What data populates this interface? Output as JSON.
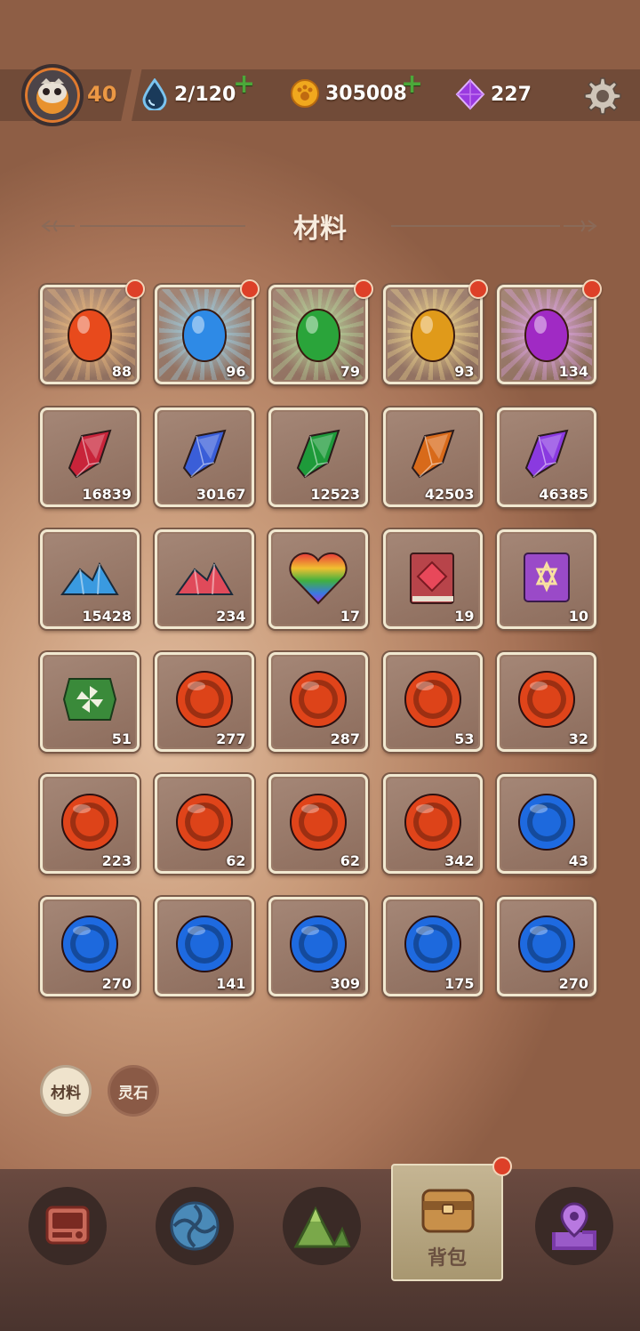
{
  "player": {
    "level": "40"
  },
  "resources": {
    "energy": "2/120",
    "coins": "305008",
    "gems": "227"
  },
  "section_title": "材料",
  "items": [
    {
      "icon": "red-egg-icon",
      "qty": "88",
      "badge": true,
      "kind": "egg",
      "color": "#e84a1c",
      "glow": "#f4c080"
    },
    {
      "icon": "blue-egg-icon",
      "qty": "96",
      "badge": true,
      "kind": "egg",
      "color": "#2e8ae6",
      "glow": "#9ed8f0"
    },
    {
      "icon": "green-egg-icon",
      "qty": "79",
      "badge": true,
      "kind": "egg",
      "color": "#2aa43a",
      "glow": "#b8e0a0"
    },
    {
      "icon": "yellow-egg-icon",
      "qty": "93",
      "badge": true,
      "kind": "egg",
      "color": "#e09a1a",
      "glow": "#f4dc90"
    },
    {
      "icon": "purple-egg-icon",
      "qty": "134",
      "badge": true,
      "kind": "egg",
      "color": "#a02ac4",
      "glow": "#e4a8f0"
    },
    {
      "icon": "red-crystal-icon",
      "qty": "16839",
      "kind": "crystal",
      "color": "#c8243a"
    },
    {
      "icon": "blue-crystal-icon",
      "qty": "30167",
      "kind": "crystal",
      "color": "#3a5ed8"
    },
    {
      "icon": "green-crystal-icon",
      "qty": "12523",
      "kind": "crystal",
      "color": "#1e9a3a"
    },
    {
      "icon": "orange-crystal-icon",
      "qty": "42503",
      "kind": "crystal",
      "color": "#d86a1a"
    },
    {
      "icon": "purple-crystal-icon",
      "qty": "46385",
      "kind": "crystal",
      "color": "#8a3ae0"
    },
    {
      "icon": "blue-shard-pile-icon",
      "qty": "15428",
      "kind": "pile",
      "color": "#3a9ae0"
    },
    {
      "icon": "red-shard-pile-icon",
      "qty": "234",
      "kind": "pile",
      "color": "#e04a5a"
    },
    {
      "icon": "rainbow-heart-icon",
      "qty": "17",
      "kind": "heart",
      "color": "#e04a5a"
    },
    {
      "icon": "red-book-icon",
      "qty": "19",
      "kind": "book",
      "color": "#b8444a"
    },
    {
      "icon": "purple-star-card-icon",
      "qty": "10",
      "kind": "card",
      "color": "#9a4ac8"
    },
    {
      "icon": "green-pinwheel-ticket-icon",
      "qty": "51",
      "kind": "ticket",
      "color": "#3a8a3a"
    },
    {
      "icon": "fire-orb-horned-icon",
      "qty": "277",
      "kind": "orb",
      "color": "#e0441a"
    },
    {
      "icon": "fire-orb-dome-icon",
      "qty": "287",
      "kind": "orb",
      "color": "#e0441a"
    },
    {
      "icon": "fire-orb-flame-icon",
      "qty": "53",
      "kind": "orb",
      "color": "#e0441a"
    },
    {
      "icon": "fire-orb-creature-icon",
      "qty": "32",
      "kind": "orb",
      "color": "#e0441a"
    },
    {
      "icon": "fire-orb-block-icon",
      "qty": "223",
      "kind": "orb",
      "color": "#e0441a"
    },
    {
      "icon": "fire-orb-fox-icon",
      "qty": "62",
      "kind": "orb",
      "color": "#e0441a"
    },
    {
      "icon": "fire-orb-beast-icon",
      "qty": "62",
      "kind": "orb",
      "color": "#e0441a"
    },
    {
      "icon": "fire-orb-bull-icon",
      "qty": "342",
      "kind": "orb",
      "color": "#e0441a"
    },
    {
      "icon": "water-orb-goblin-icon",
      "qty": "43",
      "kind": "orb",
      "color": "#1e6ae0"
    },
    {
      "icon": "water-orb-bug-icon",
      "qty": "270",
      "kind": "orb",
      "color": "#1e6ae0"
    },
    {
      "icon": "water-orb-fish-icon",
      "qty": "141",
      "kind": "orb",
      "color": "#1e6ae0"
    },
    {
      "icon": "water-orb-bull-icon",
      "qty": "309",
      "kind": "orb",
      "color": "#1e6ae0"
    },
    {
      "icon": "water-orb-cat-icon",
      "qty": "175",
      "kind": "orb",
      "color": "#1e6ae0"
    },
    {
      "icon": "water-orb-dragon-icon",
      "qty": "270",
      "kind": "orb",
      "color": "#1e6ae0"
    }
  ],
  "filters": [
    {
      "label": "材料",
      "active": true
    },
    {
      "label": "灵石",
      "active": false
    }
  ],
  "nav": {
    "active_label": "背包",
    "items": [
      "shop-icon",
      "portal-icon",
      "mountain-icon",
      "backpack-icon",
      "map-pin-icon"
    ]
  }
}
